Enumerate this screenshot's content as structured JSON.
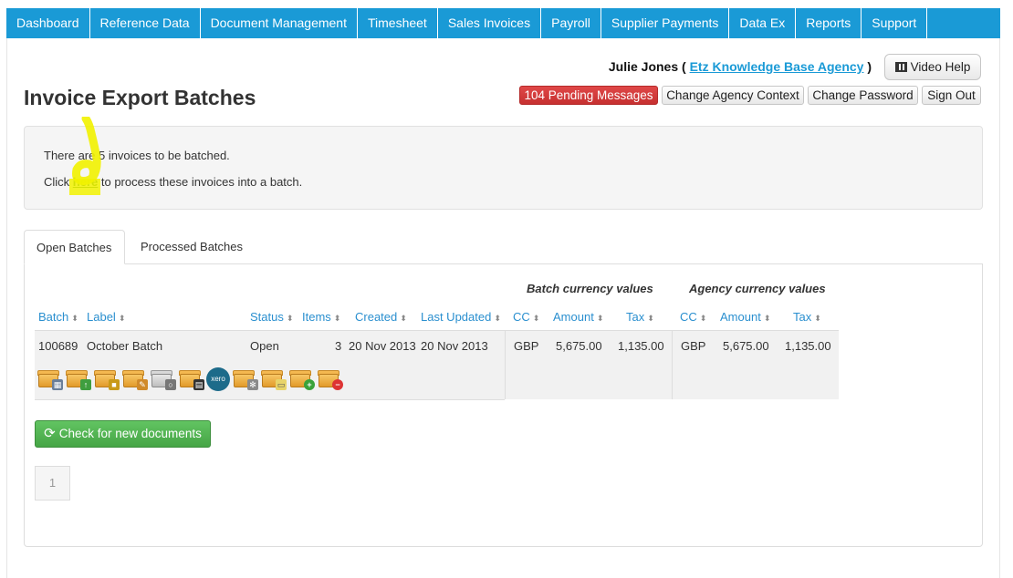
{
  "nav": {
    "items": [
      "Dashboard",
      "Reference Data",
      "Document Management",
      "Timesheet",
      "Sales Invoices",
      "Payroll",
      "Supplier Payments",
      "Data Ex",
      "Reports",
      "Support"
    ]
  },
  "header": {
    "user_name": "Julie Jones",
    "paren_open": "(",
    "agency_link": "Etz Knowledge Base Agency",
    "paren_close": ")",
    "video_help": "Video Help",
    "pending_messages": "104 Pending Messages",
    "change_agency": "Change Agency Context",
    "change_password": "Change Password",
    "sign_out": "Sign Out"
  },
  "page": {
    "title": "Invoice Export Batches"
  },
  "info": {
    "line1": "There are 5 invoices to be batched.",
    "line2_prefix": "Click ",
    "line2_link": "here",
    "line2_suffix": " to process these invoices into a batch."
  },
  "tabs": [
    "Open Batches",
    "Processed Batches"
  ],
  "table": {
    "group_batch_currency": "Batch currency values",
    "group_agency_currency": "Agency currency values",
    "columns": [
      "Batch",
      "Label",
      "Status",
      "Items",
      "Created",
      "Last Updated",
      "CC",
      "Amount",
      "Tax",
      "CC",
      "Amount",
      "Tax"
    ],
    "rows": [
      {
        "batch": "100689",
        "label": "October Batch",
        "status": "Open",
        "items": "3",
        "created": "20 Nov 2013",
        "last_updated": "20 Nov 2013",
        "batch_cc": "GBP",
        "batch_amount": "5,675.00",
        "batch_tax": "1,135.00",
        "agency_cc": "GBP",
        "agency_amount": "5,675.00",
        "agency_tax": "1,135.00"
      }
    ],
    "action_icons": [
      "invoice-calc-icon",
      "export-up-icon",
      "lock-icon",
      "edit-pencil-icon",
      "search-magnify-icon",
      "print-icon",
      "xero-icon",
      "settings-gear-icon",
      "document-icon",
      "add-icon",
      "delete-icon"
    ],
    "xero_label": "xero"
  },
  "actions": {
    "check_new": "Check for new documents"
  },
  "pagination": {
    "current": "1"
  },
  "colors": {
    "nav_bg": "#1a9ad6",
    "pending_red": "#d43f3f",
    "check_green": "#51b351",
    "link_blue": "#2a8fcf",
    "highlight": "#f5f500"
  }
}
